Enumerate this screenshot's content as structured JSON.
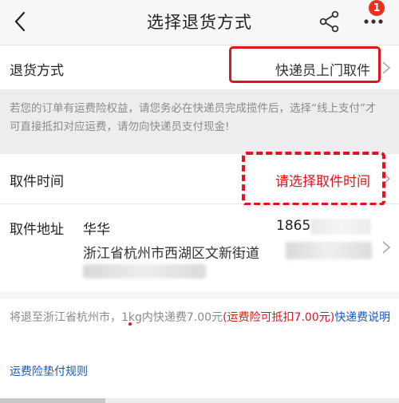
{
  "header": {
    "title": "选择退货方式",
    "back_icon": "chevron-left-icon",
    "share_icon": "share-icon",
    "more_icon": "more-dots-icon",
    "badge": "1"
  },
  "return_method": {
    "label": "退货方式",
    "value": "快递员上门取件"
  },
  "notice": {
    "text": "若您的订单有运费险权益，请您务必在快递员完成揽件后，选择“线上支付”才可直接抵扣对应运费，请勿向快递员支付现金!"
  },
  "pickup_time": {
    "label": "取件时间",
    "value": "请选择取件时间"
  },
  "pickup_address": {
    "label": "取件地址",
    "name": "华华",
    "phone": "1865",
    "address": "浙江省杭州市西湖区文新街道"
  },
  "fee": {
    "text_before": "将退至浙江省杭州市，1kg内快递费7.00元",
    "text_red": "(运费险可抵扣7.00元)",
    "link": "快递费说明"
  },
  "rules_link": "运费险垫付规则",
  "colors": {
    "accent_red": "#e0141f",
    "link_blue": "#1a57b8",
    "muted_gray": "#8a8a8a"
  }
}
